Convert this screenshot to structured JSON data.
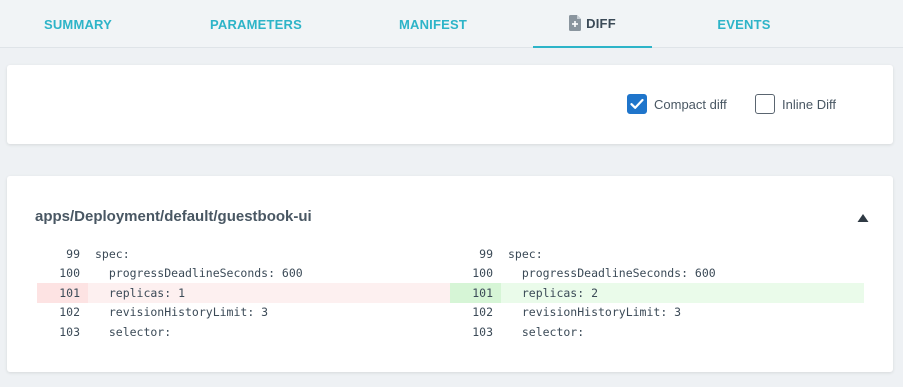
{
  "tabs": {
    "summary": "SUMMARY",
    "parameters": "PARAMETERS",
    "manifest": "MANIFEST",
    "diff": "DIFF",
    "events": "EVENTS"
  },
  "options": {
    "compact_diff": {
      "label": "Compact diff",
      "checked": true
    },
    "inline_diff": {
      "label": "Inline Diff",
      "checked": false
    }
  },
  "resource": {
    "title": "apps/Deployment/default/guestbook-ui"
  },
  "diff": {
    "left": [
      {
        "num": "99",
        "text": "spec:",
        "type": "context"
      },
      {
        "num": "100",
        "text": "  progressDeadlineSeconds: 600",
        "type": "context"
      },
      {
        "num": "101",
        "text": "  replicas: 1",
        "type": "removed"
      },
      {
        "num": "102",
        "text": "  revisionHistoryLimit: 3",
        "type": "context"
      },
      {
        "num": "103",
        "text": "  selector:",
        "type": "context"
      }
    ],
    "right": [
      {
        "num": "99",
        "text": "spec:",
        "type": "context"
      },
      {
        "num": "100",
        "text": "  progressDeadlineSeconds: 600",
        "type": "context"
      },
      {
        "num": "101",
        "text": "  replicas: 2",
        "type": "added"
      },
      {
        "num": "102",
        "text": "  revisionHistoryLimit: 3",
        "type": "context"
      },
      {
        "num": "103",
        "text": "  selector:",
        "type": "context"
      }
    ]
  },
  "colors": {
    "accent": "#2db4c8",
    "checkbox": "#1f75cb",
    "removed_bg": "#fdf0f0",
    "added_bg": "#eafbea"
  },
  "icons": {
    "diff_tab": "file-diff-icon",
    "collapse": "caret-up-icon",
    "check": "check-icon"
  }
}
